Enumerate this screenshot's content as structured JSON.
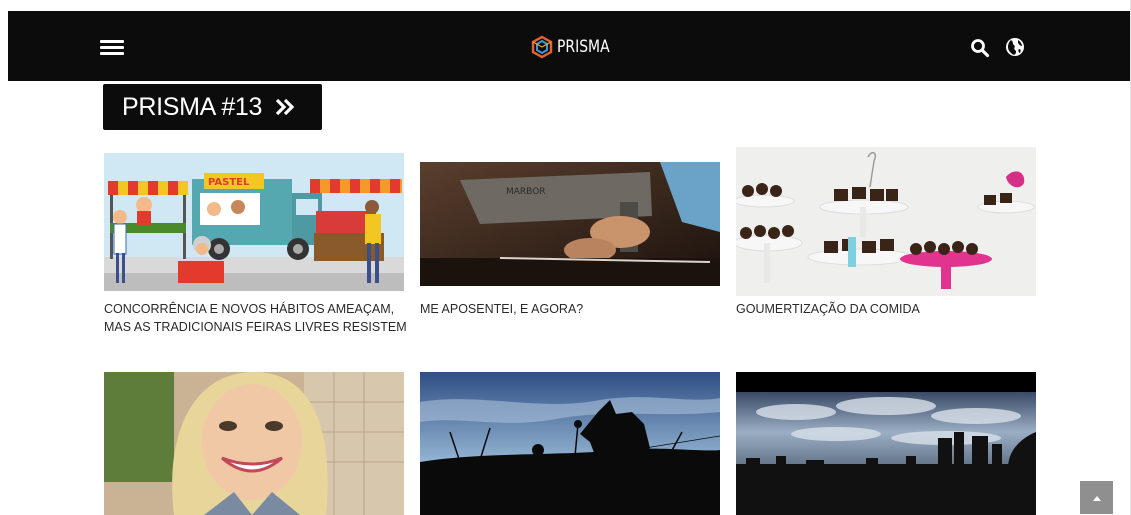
{
  "header": {
    "logo_text": "PRISMA",
    "icons": {
      "menu": "hamburger-icon",
      "logo": "prisma-logo",
      "search": "search-icon",
      "language": "globe-icon"
    }
  },
  "issue_button": {
    "label": "PRISMA #13",
    "icon": "double-chevron-right-icon"
  },
  "articles": [
    {
      "title": "CONCORRÊNCIA E NOVOS HÁBITOS AMEAÇAM, MAS AS TRADICIONAIS FEIRAS LIVRES RESISTEM",
      "image": "street-market-illustration",
      "sign_text": "PASTEL"
    },
    {
      "title": "ME APOSENTEI, E AGORA?",
      "image": "sewing-machine-photo",
      "sign_text": "MARBOR"
    },
    {
      "title": "GOUMERTIZAÇÃO DA COMIDA",
      "image": "chocolate-sweets-photo"
    },
    {
      "title": "",
      "image": "smiling-woman-photo"
    },
    {
      "title": "",
      "image": "dog-silhouette-photo"
    },
    {
      "title": "",
      "image": "city-skyline-clouds-photo"
    }
  ],
  "scroll_top": {
    "icon": "caret-up-icon"
  },
  "colors": {
    "header_bg": "#0c0c0c",
    "text": "#2a2a2a",
    "scroll_button": "#8f8f8f",
    "logo_orange": "#e8632a",
    "logo_blue": "#3a9ad9"
  }
}
